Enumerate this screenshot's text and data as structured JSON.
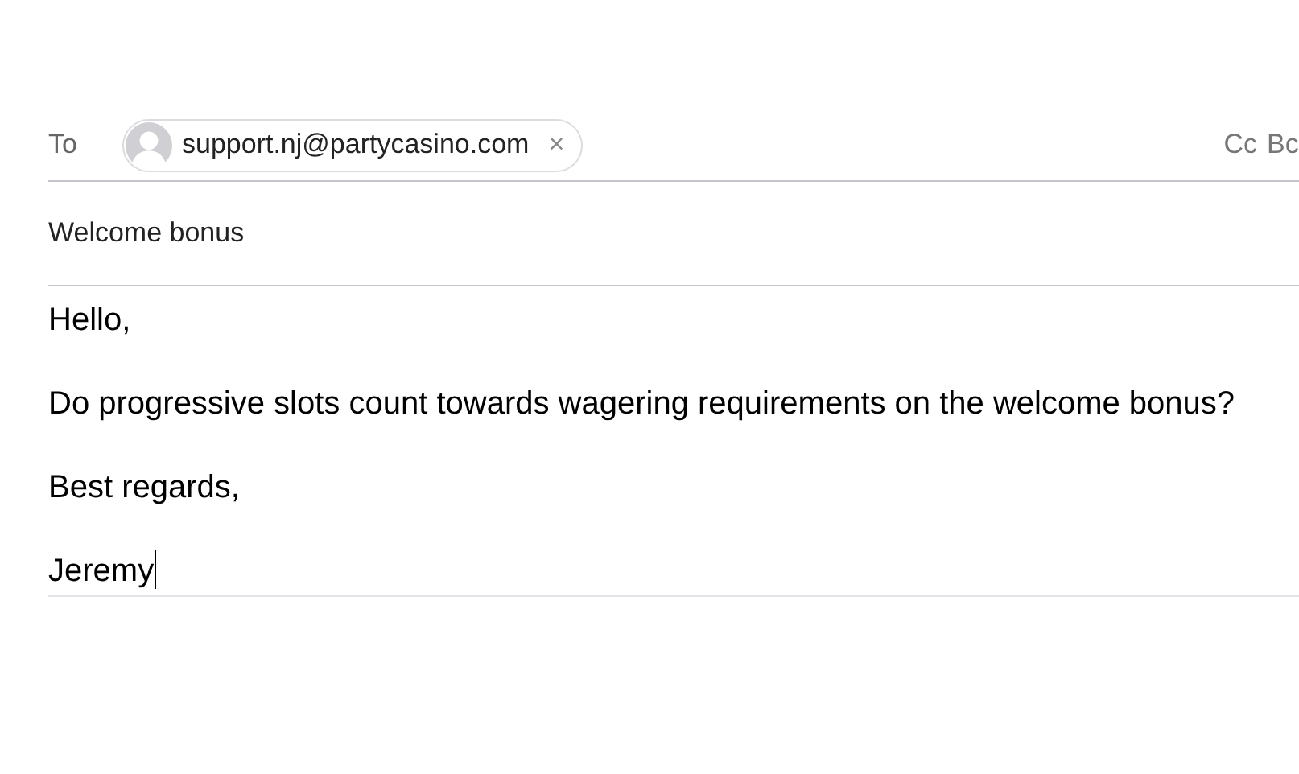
{
  "compose": {
    "to_label": "To",
    "recipients": [
      {
        "address": "support.nj@partycasino.com"
      }
    ],
    "remove_symbol": "×",
    "cc_label": "Cc",
    "bcc_label": "Bc",
    "subject": "Welcome bonus",
    "body": {
      "paragraphs": [
        "Hello,",
        "Do progressive slots count towards wagering requirements on the welcome bonus?",
        "Best regards,",
        "Jeremy"
      ],
      "caret": true
    }
  }
}
